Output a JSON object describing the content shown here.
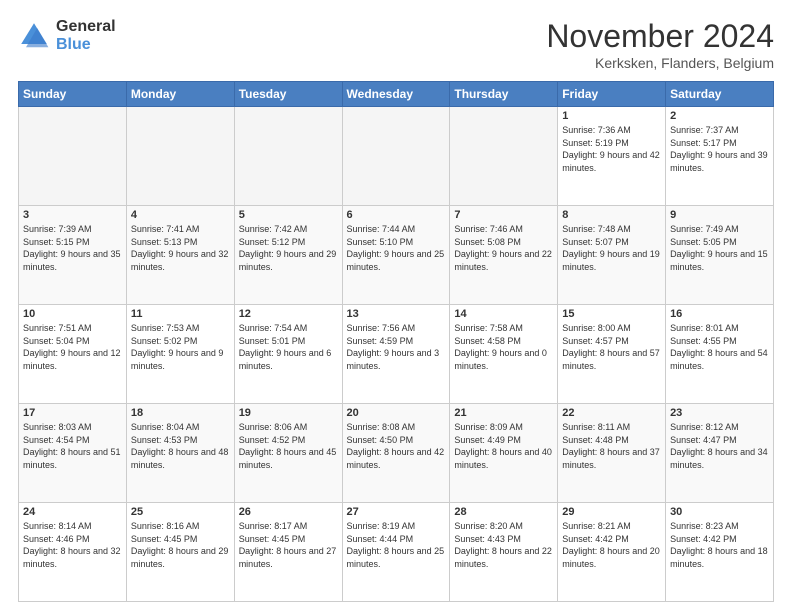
{
  "header": {
    "logo_general": "General",
    "logo_blue": "Blue",
    "month_title": "November 2024",
    "location": "Kerksken, Flanders, Belgium"
  },
  "days_of_week": [
    "Sunday",
    "Monday",
    "Tuesday",
    "Wednesday",
    "Thursday",
    "Friday",
    "Saturday"
  ],
  "weeks": [
    [
      {
        "day": "",
        "empty": true
      },
      {
        "day": "",
        "empty": true
      },
      {
        "day": "",
        "empty": true
      },
      {
        "day": "",
        "empty": true
      },
      {
        "day": "",
        "empty": true
      },
      {
        "day": "1",
        "sunrise": "Sunrise: 7:36 AM",
        "sunset": "Sunset: 5:19 PM",
        "daylight": "Daylight: 9 hours and 42 minutes."
      },
      {
        "day": "2",
        "sunrise": "Sunrise: 7:37 AM",
        "sunset": "Sunset: 5:17 PM",
        "daylight": "Daylight: 9 hours and 39 minutes."
      }
    ],
    [
      {
        "day": "3",
        "sunrise": "Sunrise: 7:39 AM",
        "sunset": "Sunset: 5:15 PM",
        "daylight": "Daylight: 9 hours and 35 minutes."
      },
      {
        "day": "4",
        "sunrise": "Sunrise: 7:41 AM",
        "sunset": "Sunset: 5:13 PM",
        "daylight": "Daylight: 9 hours and 32 minutes."
      },
      {
        "day": "5",
        "sunrise": "Sunrise: 7:42 AM",
        "sunset": "Sunset: 5:12 PM",
        "daylight": "Daylight: 9 hours and 29 minutes."
      },
      {
        "day": "6",
        "sunrise": "Sunrise: 7:44 AM",
        "sunset": "Sunset: 5:10 PM",
        "daylight": "Daylight: 9 hours and 25 minutes."
      },
      {
        "day": "7",
        "sunrise": "Sunrise: 7:46 AM",
        "sunset": "Sunset: 5:08 PM",
        "daylight": "Daylight: 9 hours and 22 minutes."
      },
      {
        "day": "8",
        "sunrise": "Sunrise: 7:48 AM",
        "sunset": "Sunset: 5:07 PM",
        "daylight": "Daylight: 9 hours and 19 minutes."
      },
      {
        "day": "9",
        "sunrise": "Sunrise: 7:49 AM",
        "sunset": "Sunset: 5:05 PM",
        "daylight": "Daylight: 9 hours and 15 minutes."
      }
    ],
    [
      {
        "day": "10",
        "sunrise": "Sunrise: 7:51 AM",
        "sunset": "Sunset: 5:04 PM",
        "daylight": "Daylight: 9 hours and 12 minutes."
      },
      {
        "day": "11",
        "sunrise": "Sunrise: 7:53 AM",
        "sunset": "Sunset: 5:02 PM",
        "daylight": "Daylight: 9 hours and 9 minutes."
      },
      {
        "day": "12",
        "sunrise": "Sunrise: 7:54 AM",
        "sunset": "Sunset: 5:01 PM",
        "daylight": "Daylight: 9 hours and 6 minutes."
      },
      {
        "day": "13",
        "sunrise": "Sunrise: 7:56 AM",
        "sunset": "Sunset: 4:59 PM",
        "daylight": "Daylight: 9 hours and 3 minutes."
      },
      {
        "day": "14",
        "sunrise": "Sunrise: 7:58 AM",
        "sunset": "Sunset: 4:58 PM",
        "daylight": "Daylight: 9 hours and 0 minutes."
      },
      {
        "day": "15",
        "sunrise": "Sunrise: 8:00 AM",
        "sunset": "Sunset: 4:57 PM",
        "daylight": "Daylight: 8 hours and 57 minutes."
      },
      {
        "day": "16",
        "sunrise": "Sunrise: 8:01 AM",
        "sunset": "Sunset: 4:55 PM",
        "daylight": "Daylight: 8 hours and 54 minutes."
      }
    ],
    [
      {
        "day": "17",
        "sunrise": "Sunrise: 8:03 AM",
        "sunset": "Sunset: 4:54 PM",
        "daylight": "Daylight: 8 hours and 51 minutes."
      },
      {
        "day": "18",
        "sunrise": "Sunrise: 8:04 AM",
        "sunset": "Sunset: 4:53 PM",
        "daylight": "Daylight: 8 hours and 48 minutes."
      },
      {
        "day": "19",
        "sunrise": "Sunrise: 8:06 AM",
        "sunset": "Sunset: 4:52 PM",
        "daylight": "Daylight: 8 hours and 45 minutes."
      },
      {
        "day": "20",
        "sunrise": "Sunrise: 8:08 AM",
        "sunset": "Sunset: 4:50 PM",
        "daylight": "Daylight: 8 hours and 42 minutes."
      },
      {
        "day": "21",
        "sunrise": "Sunrise: 8:09 AM",
        "sunset": "Sunset: 4:49 PM",
        "daylight": "Daylight: 8 hours and 40 minutes."
      },
      {
        "day": "22",
        "sunrise": "Sunrise: 8:11 AM",
        "sunset": "Sunset: 4:48 PM",
        "daylight": "Daylight: 8 hours and 37 minutes."
      },
      {
        "day": "23",
        "sunrise": "Sunrise: 8:12 AM",
        "sunset": "Sunset: 4:47 PM",
        "daylight": "Daylight: 8 hours and 34 minutes."
      }
    ],
    [
      {
        "day": "24",
        "sunrise": "Sunrise: 8:14 AM",
        "sunset": "Sunset: 4:46 PM",
        "daylight": "Daylight: 8 hours and 32 minutes."
      },
      {
        "day": "25",
        "sunrise": "Sunrise: 8:16 AM",
        "sunset": "Sunset: 4:45 PM",
        "daylight": "Daylight: 8 hours and 29 minutes."
      },
      {
        "day": "26",
        "sunrise": "Sunrise: 8:17 AM",
        "sunset": "Sunset: 4:45 PM",
        "daylight": "Daylight: 8 hours and 27 minutes."
      },
      {
        "day": "27",
        "sunrise": "Sunrise: 8:19 AM",
        "sunset": "Sunset: 4:44 PM",
        "daylight": "Daylight: 8 hours and 25 minutes."
      },
      {
        "day": "28",
        "sunrise": "Sunrise: 8:20 AM",
        "sunset": "Sunset: 4:43 PM",
        "daylight": "Daylight: 8 hours and 22 minutes."
      },
      {
        "day": "29",
        "sunrise": "Sunrise: 8:21 AM",
        "sunset": "Sunset: 4:42 PM",
        "daylight": "Daylight: 8 hours and 20 minutes."
      },
      {
        "day": "30",
        "sunrise": "Sunrise: 8:23 AM",
        "sunset": "Sunset: 4:42 PM",
        "daylight": "Daylight: 8 hours and 18 minutes."
      }
    ]
  ]
}
